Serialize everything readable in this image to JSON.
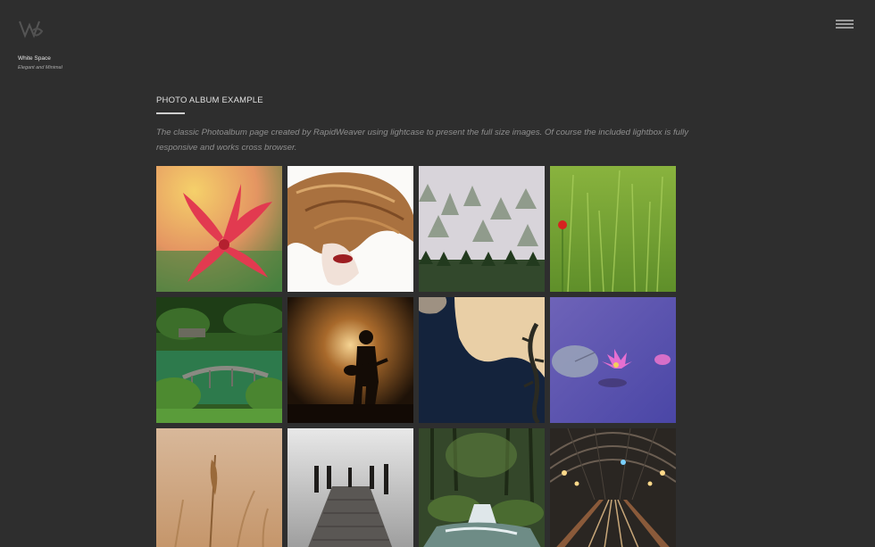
{
  "site": {
    "title": "White Space",
    "tagline": "Elegant and Minimal",
    "logo_icon": "ws-monogram-icon",
    "menu_icon": "hamburger-menu-icon"
  },
  "page": {
    "title": "PHOTO ALBUM EXAMPLE",
    "intro": "The classic Photoalbum page created by RapidWeaver using lightcase to present the full size images. Of course the included lightbox is fully responsive and works cross browser."
  },
  "colors": {
    "background": "#2e2e2e",
    "accent_rule": "#cfcfcf",
    "intro_text": "#8f8f8f"
  },
  "album": {
    "photos": [
      {
        "subject": "red-flower"
      },
      {
        "subject": "hair-portrait"
      },
      {
        "subject": "snowy-forest"
      },
      {
        "subject": "green-wheat-poppy"
      },
      {
        "subject": "japanese-garden-bridge"
      },
      {
        "subject": "guitarist-silhouette"
      },
      {
        "subject": "lizard-reflection"
      },
      {
        "subject": "water-lily"
      },
      {
        "subject": "golden-wheat"
      },
      {
        "subject": "pier-in-fog"
      },
      {
        "subject": "forest-waterfall"
      },
      {
        "subject": "train-station"
      }
    ]
  }
}
